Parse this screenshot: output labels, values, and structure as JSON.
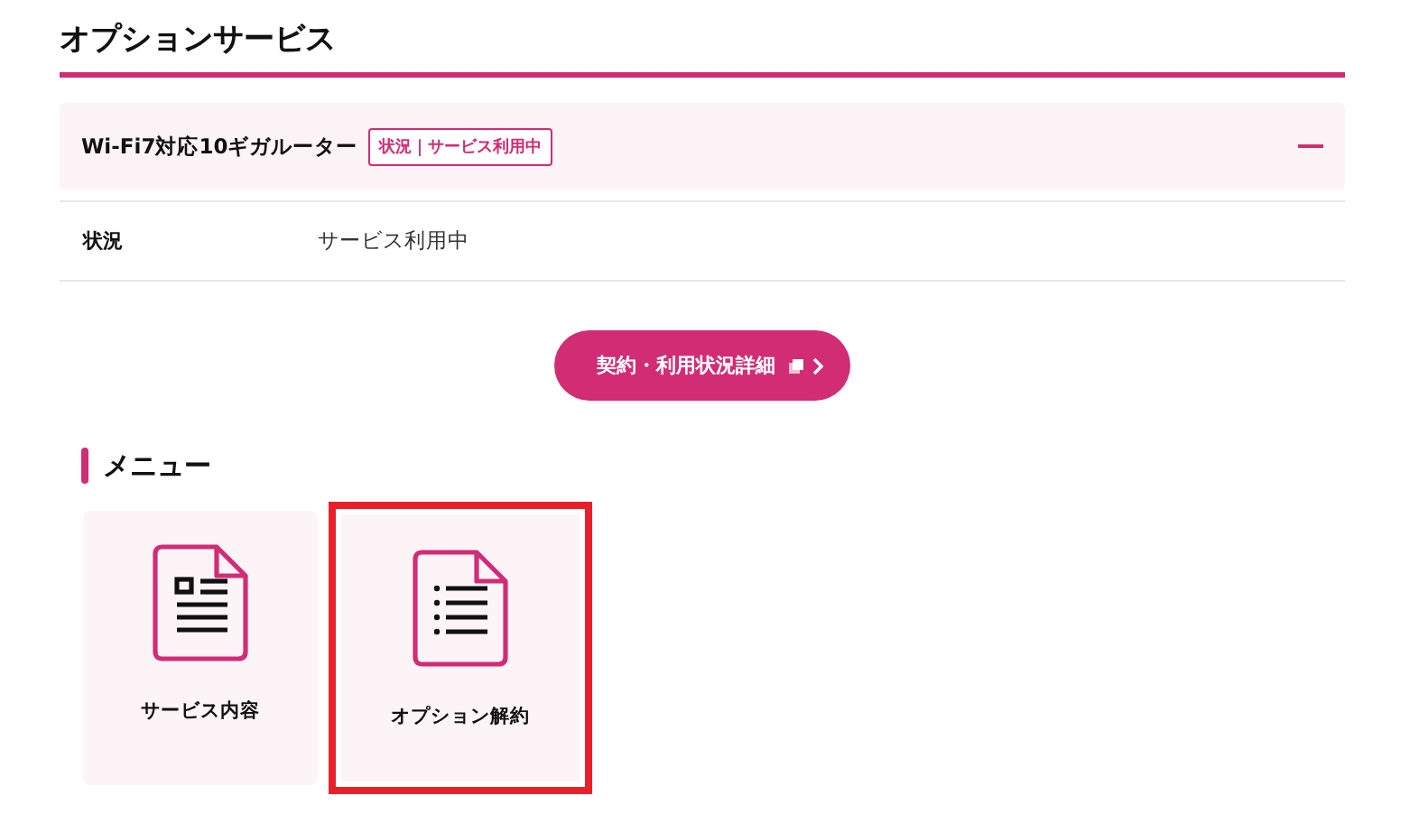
{
  "page_title": "オプションサービス",
  "accordion": {
    "title": "Wi-Fi7対応10ギガルーター",
    "badge": "状況｜サービス利用中",
    "expanded": true,
    "rows": [
      {
        "label": "状況",
        "value": "サービス利用中"
      }
    ]
  },
  "detail_button": {
    "label": "契約・利用状況詳細"
  },
  "menu": {
    "heading": "メニュー",
    "items": [
      {
        "label": "サービス内容",
        "kind": "form",
        "highlighted": false
      },
      {
        "label": "オプション解約",
        "kind": "list",
        "highlighted": true
      }
    ]
  }
}
